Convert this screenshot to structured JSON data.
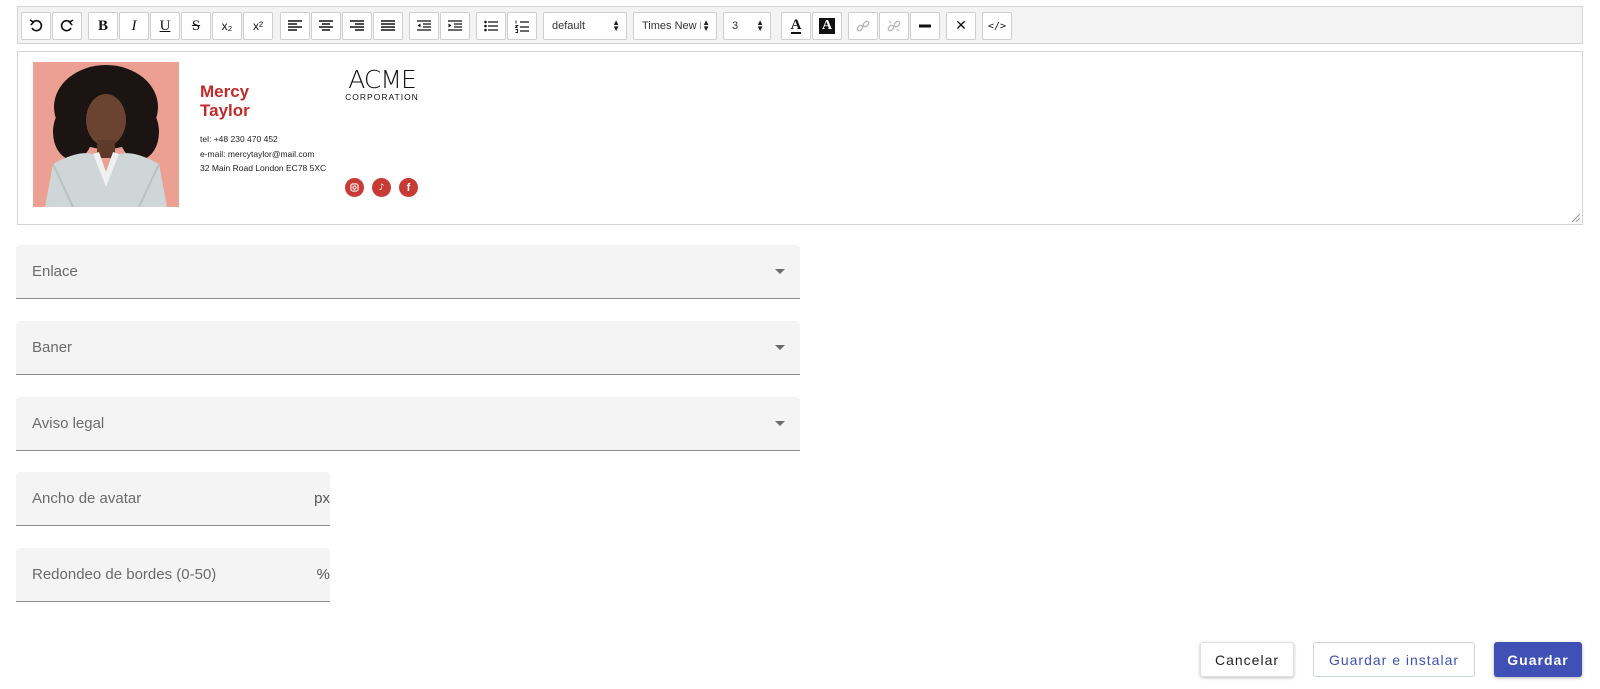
{
  "toolbar": {
    "buttons": [
      {
        "name": "undo",
        "glyph": "↶"
      },
      {
        "name": "redo",
        "glyph": "↷"
      },
      {
        "name": "bold",
        "glyph": "B"
      },
      {
        "name": "italic",
        "glyph": "I"
      },
      {
        "name": "underline",
        "glyph": "U"
      },
      {
        "name": "strikethrough",
        "glyph": "S"
      },
      {
        "name": "subscript",
        "glyph": "x₂"
      },
      {
        "name": "superscript",
        "glyph": "x²"
      }
    ],
    "format_select": "default",
    "font_select": "Times New R",
    "size_select": "3"
  },
  "signature": {
    "first_name": "Mercy",
    "last_name": "Taylor",
    "tel_label": "tel:",
    "tel": "+48 230 470 452",
    "email_label": "e-mail:",
    "email": "mercytaylor@mail.com",
    "address": "32 Main Road London EC78 5XC",
    "logo_main": "ACME",
    "logo_sub": "CORPORATION",
    "social_icons": [
      "instagram-icon",
      "tiktok-icon",
      "facebook-icon"
    ]
  },
  "fields": {
    "link": "Enlace",
    "banner": "Baner",
    "legal": "Aviso legal",
    "avatar_width": "Ancho de avatar",
    "avatar_width_suffix": "px",
    "border_radius": "Redondeo de bordes (0-50)",
    "border_radius_suffix": "%"
  },
  "actions": {
    "cancel": "Cancelar",
    "save_install": "Guardar e instalar",
    "save": "Guardar"
  },
  "colors": {
    "accent": "#3f51b5",
    "name_red": "#c02a2a",
    "social_red": "#c83a34"
  }
}
